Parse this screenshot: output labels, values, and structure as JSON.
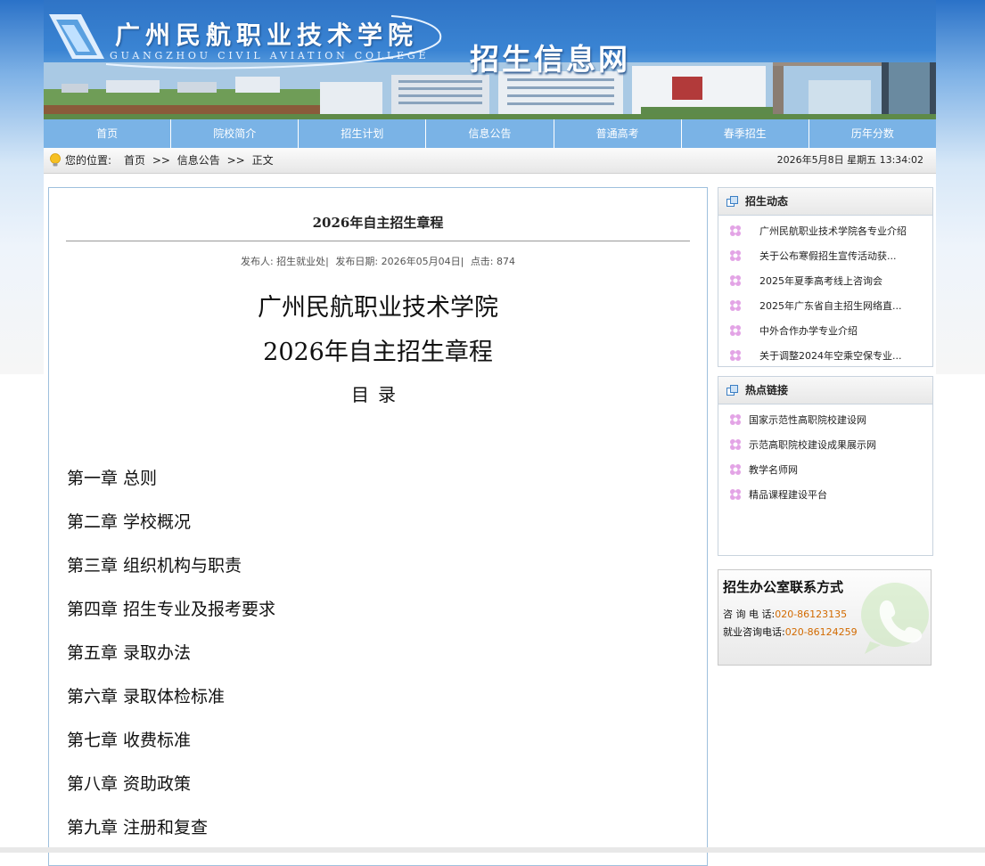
{
  "header": {
    "college_cn": "广州民航职业技术学院",
    "college_en": "GUANGZHOU CIVIL AVIATION COLLEGE",
    "site_name": "招生信息网",
    "gate_text": "广州民航职业技术学院"
  },
  "nav": {
    "items": [
      {
        "label": "首页"
      },
      {
        "label": "院校简介"
      },
      {
        "label": "招生计划"
      },
      {
        "label": "信息公告"
      },
      {
        "label": "普通高考"
      },
      {
        "label": "春季招生"
      },
      {
        "label": "历年分数"
      }
    ]
  },
  "location": {
    "label": "您的位置:",
    "crumbs": [
      "首页",
      ">>",
      "信息公告",
      ">>",
      "正文"
    ],
    "datetime": "2026年5月8日  星期五  13:34:02"
  },
  "article": {
    "title": "2026年自主招生章程",
    "meta": {
      "publisher": "发布人: 招生就业处|",
      "date": "发布日期: 2026年05月04日|",
      "clicks": "点击: 874"
    },
    "doc_title_line1": "广州民航职业技术学院",
    "doc_title_line2": "2026年自主招生章程",
    "toc_heading": "目录",
    "chapters": [
      "第一章 总则",
      "第二章 学校概况",
      "第三章 组织机构与职责",
      "第四章 招生专业及报考要求",
      "第五章 录取办法",
      "第六章 录取体检标准",
      "第七章 收费标准",
      "第八章 资助政策",
      "第九章 注册和复查"
    ]
  },
  "sidebar": {
    "news": {
      "title": "招生动态",
      "items": [
        "广州民航职业技术学院各专业介绍",
        "关于公布寒假招生宣传活动获...",
        "2025年夏季高考线上咨询会",
        "2025年广东省自主招生网络直...",
        "中外合作办学专业介绍",
        "关于调整2024年空乘空保专业..."
      ]
    },
    "links": {
      "title": "热点链接",
      "items": [
        "国家示范性高职院校建设网",
        "示范高职院校建设成果展示网",
        "教学名师网",
        "精品课程建设平台"
      ]
    },
    "contact": {
      "title": "招生办公室联系方式",
      "consult_label": "咨  询  电    话:",
      "consult_number": "020-86123135",
      "job_label": "就业咨询电话:",
      "job_number": "020-86124259"
    }
  },
  "colors": {
    "nav_bg": "#7ab3e6",
    "banner_top": "#2f74c6",
    "contact_number": "#d26a00",
    "article_border": "#9fc0dd"
  },
  "icons": {
    "location": "lightbulb-icon",
    "section_header": "window-icon",
    "list_bullet": "flower-icon",
    "contact": "phone-icon"
  }
}
